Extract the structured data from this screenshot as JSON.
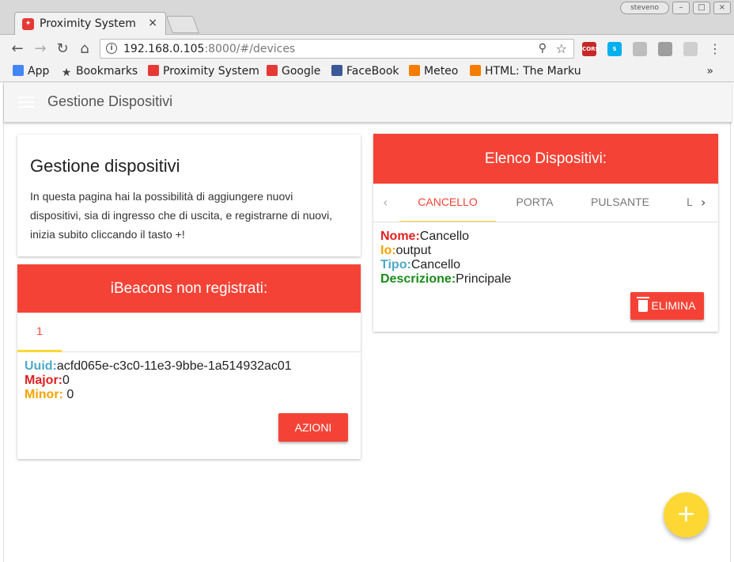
{
  "browser": {
    "tab_title": "Proximity System",
    "tab_close": "×",
    "url_host": "192.168.0.105",
    "url_rest": ":8000/#/devices",
    "user_label": "steveno",
    "bookmarks": [
      {
        "label": "App",
        "icon": "apps-grid-icon",
        "color": "#4285f4"
      },
      {
        "label": "Bookmarks",
        "icon": "star-icon",
        "color": "#444444"
      },
      {
        "label": "Proximity System",
        "icon": "proximity-favicon",
        "color": "#e53935"
      },
      {
        "label": "Google",
        "icon": "google-icon",
        "color": "#e53935"
      },
      {
        "label": "FaceBook",
        "icon": "facebook-icon",
        "color": "#3b5998"
      },
      {
        "label": "Meteo",
        "icon": "meteo-icon",
        "color": "#f57c00"
      },
      {
        "label": "HTML: The Marku",
        "icon": "w3schools-icon",
        "color": "#f57c00"
      }
    ],
    "bookmarks_more": "»",
    "extensions": [
      {
        "name": "cors-extension-icon",
        "text": "CORS",
        "color": "#c62828"
      },
      {
        "name": "skype-extension-icon",
        "text": "S",
        "color": "#00aff0"
      },
      {
        "name": "camera-extension-icon",
        "text": "",
        "color": "#bdbdbd"
      },
      {
        "name": "shield-extension-icon",
        "text": "",
        "color": "#9e9e9e"
      },
      {
        "name": "target-extension-icon",
        "text": "",
        "color": "#cfcfcf"
      }
    ]
  },
  "app": {
    "title": "Gestione Dispositivi"
  },
  "intro_card": {
    "title": "Gestione dispositivi",
    "text": "In questa pagina hai la possibilità di aggiungere nuovi dispositivi, sia di ingresso che di uscita, e registrarne di nuovi, inizia subito cliccando il tasto +!"
  },
  "beacons_card": {
    "header": "iBeacons non registrati:",
    "tabs": [
      "1"
    ],
    "fields": [
      {
        "label": "Uuid:",
        "value": "acfd065e-c3c0-11e3-9bbe-1a514932ac01",
        "color": "#4fa8c8"
      },
      {
        "label": "Major:",
        "value": "0",
        "color": "#e02020"
      },
      {
        "label": "Minor:",
        "value": " 0",
        "color": "#f5a300"
      }
    ],
    "action_button": "AZIONI"
  },
  "devices_card": {
    "header": "Elenco Dispositivi:",
    "tabs": [
      "CANCELLO",
      "PORTA",
      "PULSANTE",
      "L"
    ],
    "fields": [
      {
        "label": "Nome:",
        "value": "Cancello",
        "color": "#e02020"
      },
      {
        "label": "Io:",
        "value": "output",
        "color": "#f5a300"
      },
      {
        "label": "Tipo:",
        "value": "Cancello",
        "color": "#4fa8c8"
      },
      {
        "label": "Descrizione:",
        "value": "Principale",
        "color": "#1a8a1a"
      }
    ],
    "delete_button": "ELIMINA"
  },
  "fab": "+",
  "colors": {
    "primary": "#f44336",
    "accent": "#fdd835"
  }
}
